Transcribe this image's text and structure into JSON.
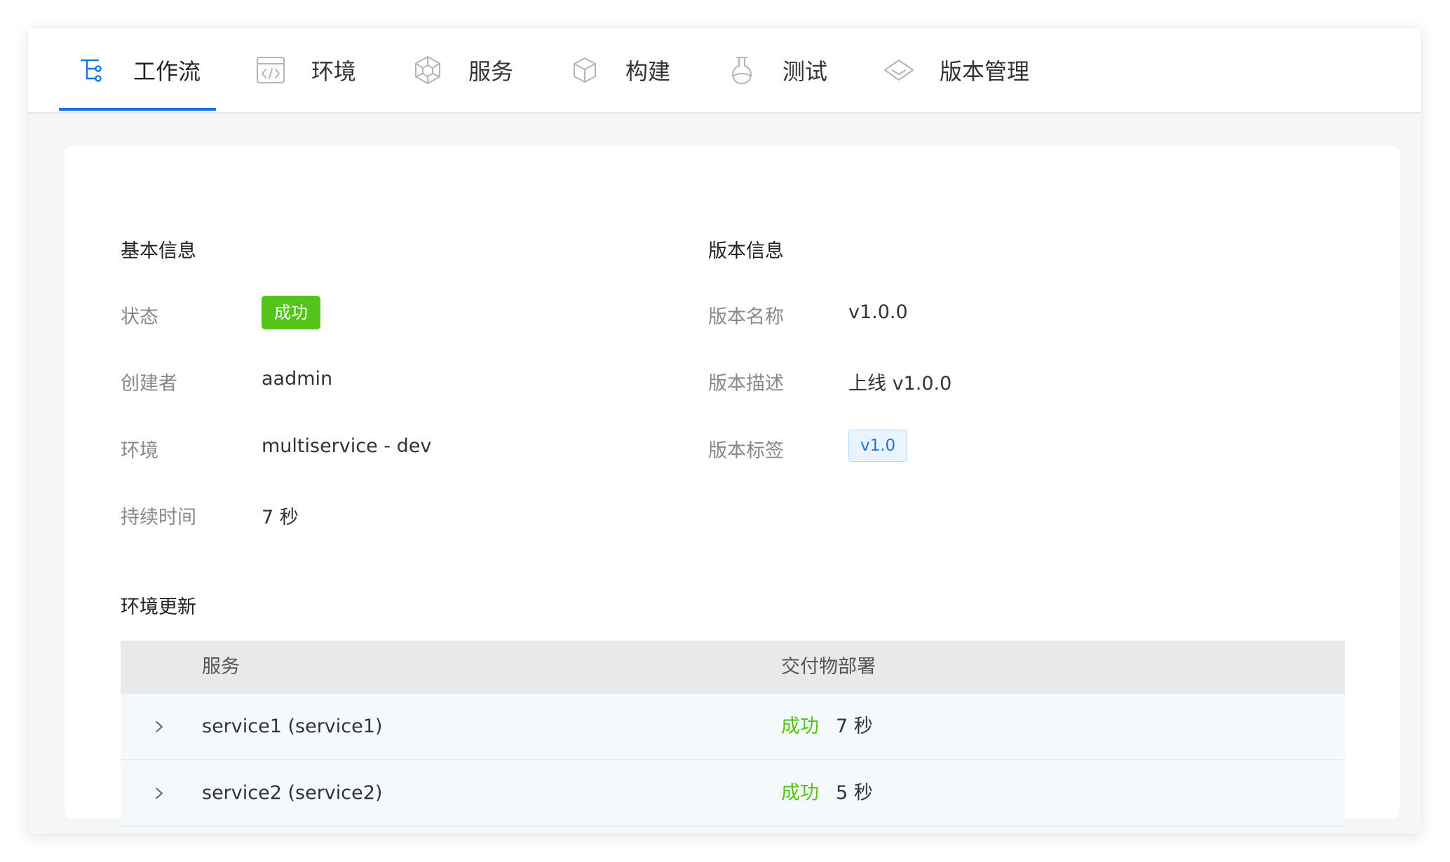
{
  "nav": {
    "items": [
      {
        "label": "工作流",
        "icon": "workflow-tree-icon",
        "active": true
      },
      {
        "label": "环境",
        "icon": "code-window-icon",
        "active": false
      },
      {
        "label": "服务",
        "icon": "cube-network-icon",
        "active": false
      },
      {
        "label": "构建",
        "icon": "box-icon",
        "active": false
      },
      {
        "label": "测试",
        "icon": "flask-icon",
        "active": false
      },
      {
        "label": "版本管理",
        "icon": "tag-diamond-icon",
        "active": false
      }
    ]
  },
  "basic_info": {
    "title": "基本信息",
    "status_label": "状态",
    "status_value": "成功",
    "creator_label": "创建者",
    "creator_value": "aadmin",
    "env_label": "环境",
    "env_value": "multiservice - dev",
    "duration_label": "持续时间",
    "duration_value": "7 秒"
  },
  "version_info": {
    "title": "版本信息",
    "name_label": "版本名称",
    "name_value": "v1.0.0",
    "desc_label": "版本描述",
    "desc_value": "上线 v1.0.0",
    "tag_label": "版本标签",
    "tag_value": "v1.0"
  },
  "env_update": {
    "title": "环境更新",
    "columns": [
      "服务",
      "交付物部署"
    ],
    "rows": [
      {
        "service": "service1 (service1)",
        "status": "成功",
        "duration": "7 秒"
      },
      {
        "service": "service2 (service2)",
        "status": "成功",
        "duration": "5 秒"
      }
    ]
  },
  "colors": {
    "accent": "#1a73e8",
    "success": "#52c41a",
    "page_bg": "#f5f6f8"
  }
}
